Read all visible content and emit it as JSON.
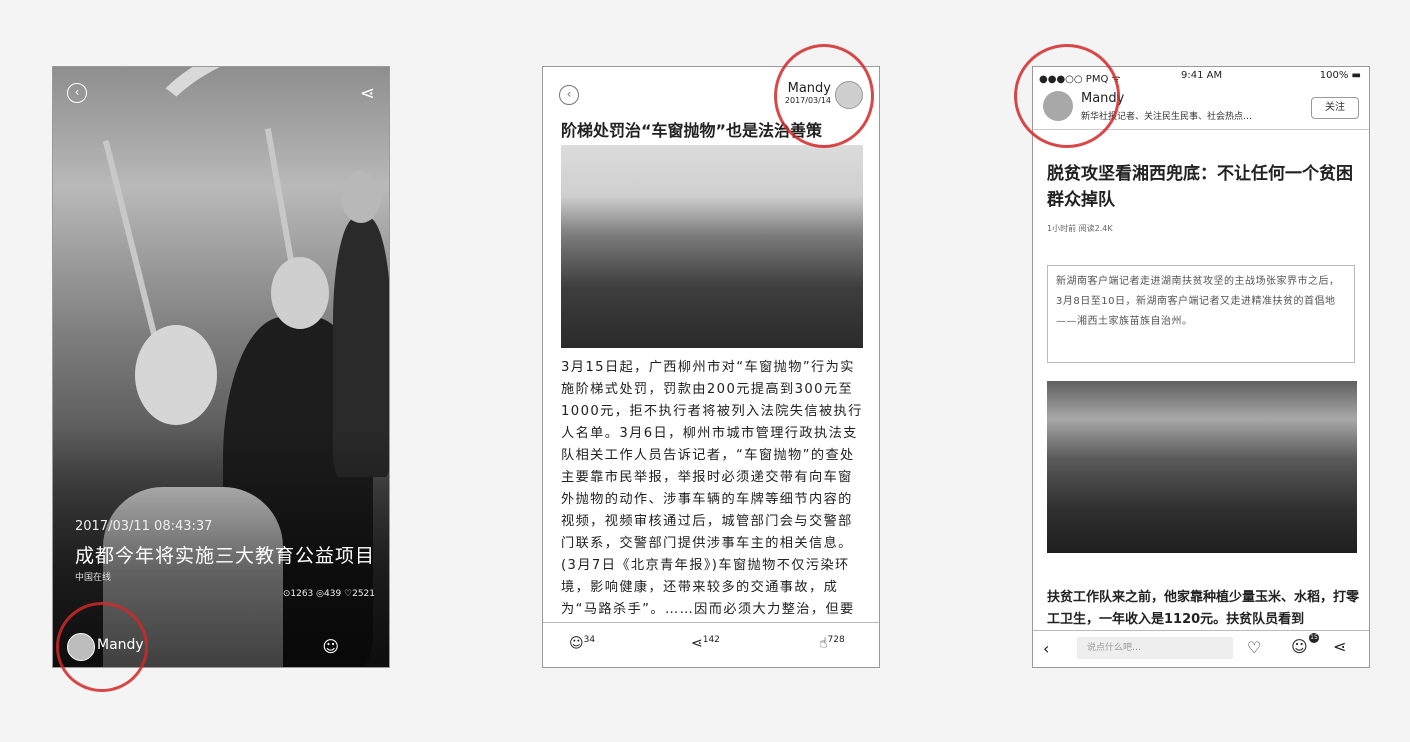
{
  "phone1": {
    "time": "2017/03/11 08:43:37",
    "title": "成都今年将实施三大教育公益项目",
    "source": "中国在线",
    "stats": "⊙1263  ◎439  ♡2521",
    "author": "Mandy",
    "back_icon": "back-circle-icon",
    "share_icon": "share-icon",
    "comment_icon": "comment-icon"
  },
  "phone2": {
    "author": "Mandy",
    "date": "2017/03/14",
    "headline": "阶梯处罚治“车窗抛物”也是法治善策",
    "body": "3月15日起，广西柳州市对“车窗抛物”行为实施阶梯式处罚，罚款由200元提高到300元至1000元，拒不执行者将被列入法院失信被执行人名单。3月6日，柳州市城市管理行政执法支队相关工作人员告诉记者，“车窗抛物”的查处主要靠市民举报，举报时必须递交带有向车窗外抛物的动作、涉事车辆的车牌等细节内容的视频，视频审核通过后，城管部门会与交警部门联系，交警部门提供涉事车主的相关信息。(3月7日《北京青年报》)车窗抛物不仅污染环境，影响健康，还带来较多的交通事故，成为“马路杀手”。……因而必须大力整治，但要取得良好效果，",
    "comments": "34",
    "shares": "142",
    "likes": "728"
  },
  "phone3": {
    "status": {
      "carrier": "●●●○○ PMQ ᯤ",
      "time": "9:41 AM",
      "battery": "100% ▬"
    },
    "author": "Mandy",
    "author_desc": "新华社报记者、关注民生民事、社会热点…",
    "follow_label": "关注",
    "title": "脱贫攻坚看湘西兜底：不让任何一个贫困群众掉队",
    "meta": "1小时前  阅读2.4K",
    "quote": "新湖南客户端记者走进湖南扶贫攻坚的主战场张家界市之后，3月8日至10日，新湖南客户端记者又走进精准扶贫的首倡地——湘西土家族苗族自治州。",
    "body": "扶贫工作队来之前，他家靠种植少量玉米、水稻，打零工卫生，一年收入是1120元。扶贫队员看到",
    "input_placeholder": "说点什么吧…",
    "badge": "15"
  }
}
